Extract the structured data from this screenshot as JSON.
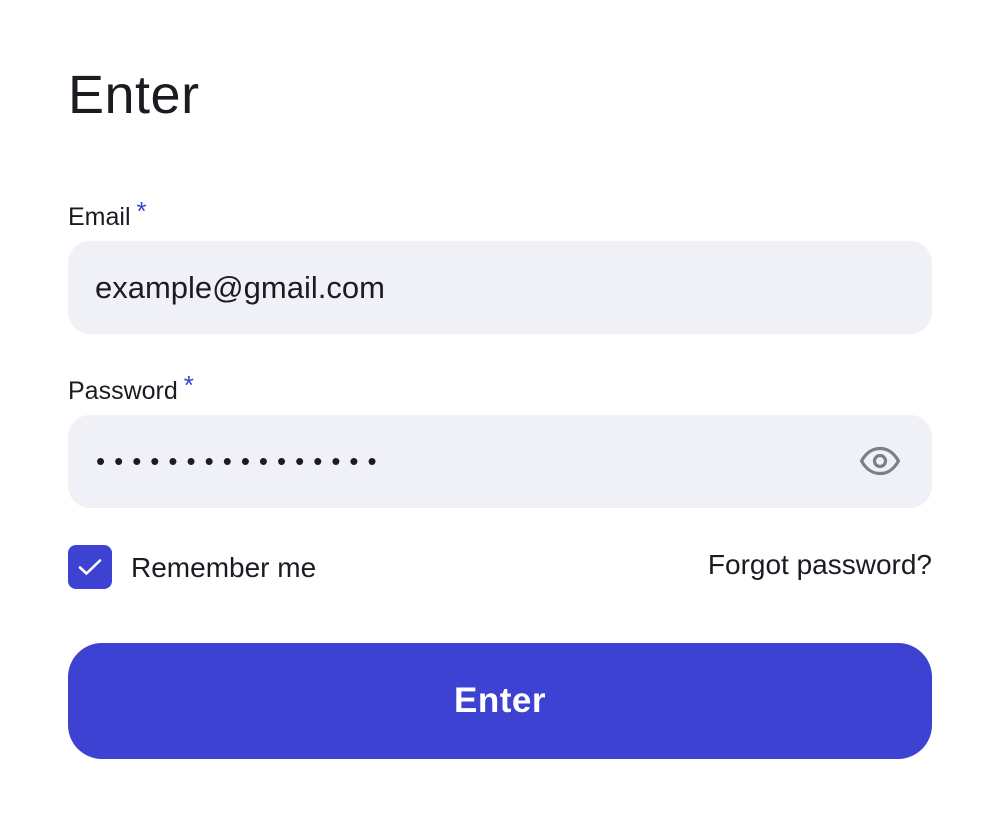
{
  "form": {
    "title": "Enter",
    "email": {
      "label": "Email",
      "required_mark": "*",
      "value": "example@gmail.com"
    },
    "password": {
      "label": "Password",
      "required_mark": "*",
      "value": "••••••••••••••••",
      "visibility_icon": "eye-icon"
    },
    "remember": {
      "label": "Remember me",
      "checked": true,
      "icon": "checkmark-icon"
    },
    "forgot_link": "Forgot password?",
    "submit_label": "Enter"
  },
  "colors": {
    "accent": "#3d42d2",
    "input_background": "#f0f1f6",
    "text": "#1c1b22",
    "icon_muted": "#7d7d8a",
    "button_text": "#ffffff"
  }
}
